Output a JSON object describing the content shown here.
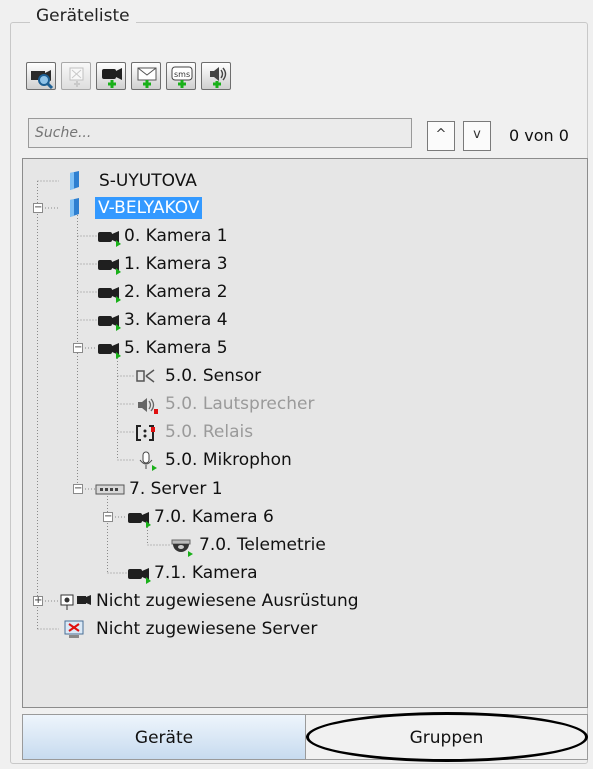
{
  "panel": {
    "title": "Geräteliste",
    "toolbar": [
      {
        "icon": "camera-search-icon",
        "disabled": false
      },
      {
        "icon": "add-empty-device-icon",
        "disabled": true
      },
      {
        "icon": "add-camera-icon",
        "disabled": false
      },
      {
        "icon": "add-email-icon",
        "disabled": false
      },
      {
        "icon": "add-sms-icon",
        "disabled": false,
        "text": "sms"
      },
      {
        "icon": "add-speaker-icon",
        "disabled": false
      }
    ],
    "search": {
      "placeholder": "Suche..."
    },
    "nav": {
      "up": "^",
      "down": "v"
    },
    "count": "0 von 0",
    "tree": [
      {
        "label": "S-UYUTOVA",
        "icon": "server-icon"
      },
      {
        "label": "V-BELYAKOV",
        "icon": "server-icon",
        "selected": true
      },
      {
        "label": "0. Kamera 1",
        "icon": "camera-icon"
      },
      {
        "label": "1. Kamera 3",
        "icon": "camera-icon"
      },
      {
        "label": "2. Kamera 2",
        "icon": "camera-icon"
      },
      {
        "label": "3. Kamera 4",
        "icon": "camera-icon"
      },
      {
        "label": "5. Kamera 5",
        "icon": "camera-icon"
      },
      {
        "label": "5.0. Sensor",
        "icon": "sensor-icon"
      },
      {
        "label": "5.0. Lautsprecher",
        "icon": "speaker-icon",
        "disabled": true
      },
      {
        "label": "5.0. Relais",
        "icon": "relay-icon",
        "disabled": true
      },
      {
        "label": "5.0. Mikrophon",
        "icon": "microphone-icon"
      },
      {
        "label": "7. Server 1",
        "icon": "video-server-icon"
      },
      {
        "label": "7.0. Kamera 6",
        "icon": "camera-icon"
      },
      {
        "label": "7.0. Telemetrie",
        "icon": "telemetry-dome-icon"
      },
      {
        "label": "7.1. Kamera",
        "icon": "camera-icon"
      },
      {
        "label": "Nicht zugewiesene Ausrüstung",
        "icon": "unassigned-equipment-icon"
      },
      {
        "label": "Nicht zugewiesene Server",
        "icon": "unassigned-server-icon"
      }
    ],
    "tabs": {
      "devices": "Geräte",
      "groups": "Gruppen"
    }
  },
  "colors": {
    "selection": "#3399ff",
    "status_green": "#19b019",
    "status_red": "#e01010"
  }
}
